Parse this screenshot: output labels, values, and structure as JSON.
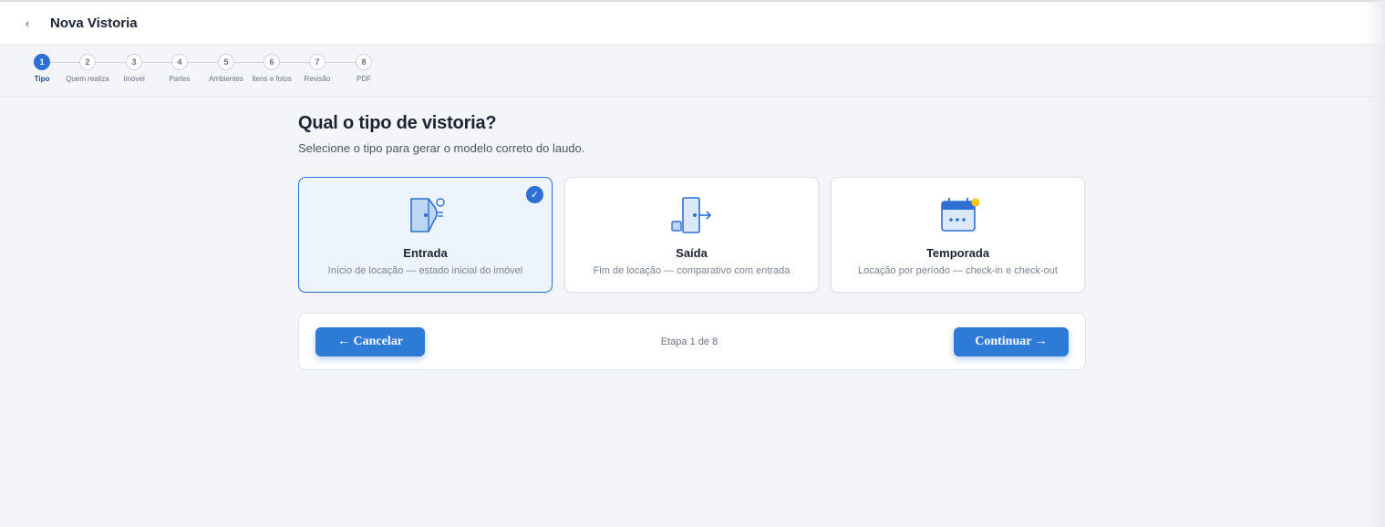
{
  "header": {
    "back_icon": "chevron-left-icon",
    "back_glyph": "‹",
    "title": "Nova Vistoria"
  },
  "stepper": {
    "active_index": 0,
    "steps": [
      {
        "number": "1",
        "label": "Tipo"
      },
      {
        "number": "2",
        "label": "Quem realiza"
      },
      {
        "number": "3",
        "label": "Imóvel"
      },
      {
        "number": "4",
        "label": "Partes"
      },
      {
        "number": "5",
        "label": "Ambientes"
      },
      {
        "number": "6",
        "label": "Itens e fotos"
      },
      {
        "number": "7",
        "label": "Revisão"
      },
      {
        "number": "8",
        "label": "PDF"
      }
    ]
  },
  "main": {
    "question": "Qual o tipo de vistoria?",
    "subtitle": "Selecione o tipo para gerar o modelo correto do laudo.",
    "cards": [
      {
        "title": "Entrada",
        "description": "Início de locação — estado inicial do imóvel",
        "icon": "door-key-icon",
        "selected": true
      },
      {
        "title": "Saída",
        "description": "Fim de locação — comparativo com entrada",
        "icon": "door-exit-icon",
        "selected": false
      },
      {
        "title": "Temporada",
        "description": "Locação por período — check-in e check-out",
        "icon": "calendar-icon",
        "selected": false
      }
    ],
    "check_glyph": "✓"
  },
  "footer": {
    "cancel_label": "← Cancelar",
    "step_counter": "Etapa 1 de 8",
    "continue_label": "Continuar →"
  },
  "colors": {
    "accent": "#2d6fd3",
    "button": "#2d7bd6",
    "background": "#f3f5f9",
    "badge_yellow": "#f5c518"
  }
}
